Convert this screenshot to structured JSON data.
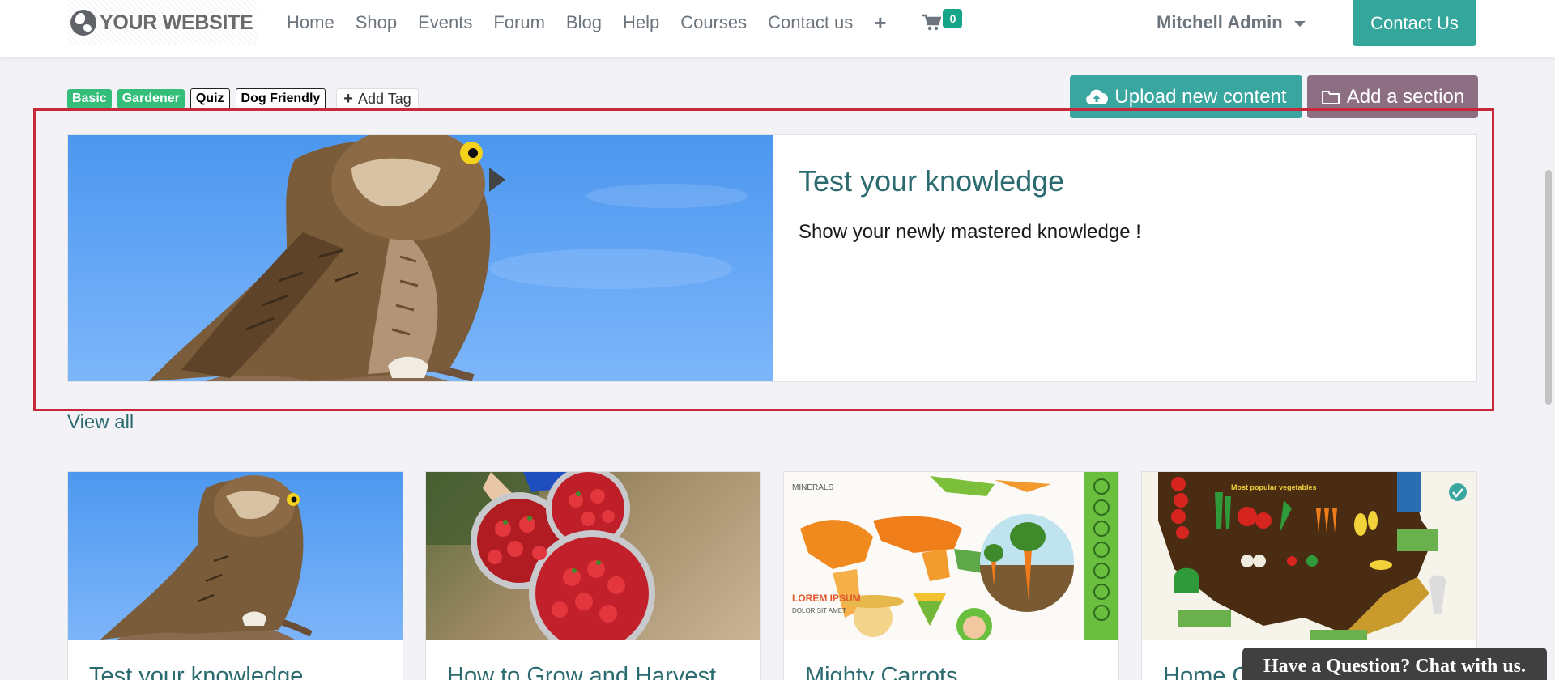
{
  "header": {
    "logo_text": "YOUR WEBSITE",
    "nav": [
      "Home",
      "Shop",
      "Events",
      "Forum",
      "Blog",
      "Help",
      "Courses",
      "Contact us"
    ],
    "plus_icon": "+",
    "cart_count": "0",
    "user_name": "Mitchell Admin",
    "contact_button": "Contact Us"
  },
  "tags": {
    "items": [
      "Basic",
      "Gardener",
      "Quiz",
      "Dog Friendly"
    ],
    "add_label": "Add Tag"
  },
  "actions": {
    "upload_label": "Upload new content",
    "section_label": "Add a section"
  },
  "featured": {
    "title": "Test your knowledge",
    "description": "Show your newly mastered knowledge !"
  },
  "view_all": "View all",
  "cards": [
    {
      "title": "Test your knowledge"
    },
    {
      "title": "How to Grow and Harvest"
    },
    {
      "title": "Mighty Carrots"
    },
    {
      "title": "Home G"
    }
  ],
  "chat": "Have a Question? Chat with us.",
  "colors": {
    "accent": "#35a69c",
    "upload": "#3aa6a0",
    "section": "#8d6f83",
    "highlight": "#c8283b",
    "title_text": "#2b6b6f",
    "tag_green": "#34be7a"
  }
}
